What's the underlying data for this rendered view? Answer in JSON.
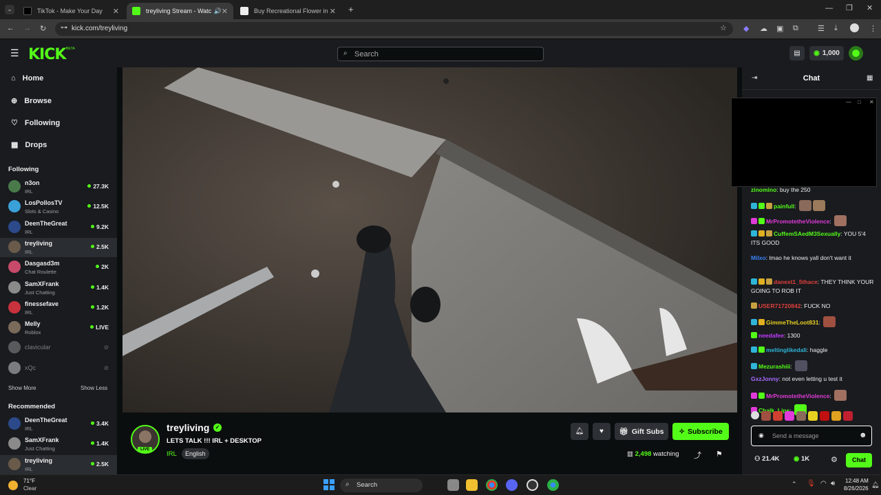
{
  "browser": {
    "tabs": [
      {
        "title": "TikTok - Make Your Day",
        "active": false
      },
      {
        "title": "treyliving Stream - Watch Li",
        "active": true
      },
      {
        "title": "Buy Recreational Flower in Las",
        "active": false
      }
    ],
    "url": "kick.com/treyliving"
  },
  "header": {
    "logo": "KICK",
    "beta": "BETA",
    "search_placeholder": "Search",
    "coins": "1,000"
  },
  "sidebar": {
    "nav": [
      {
        "label": "Home",
        "icon": "home-icon"
      },
      {
        "label": "Browse",
        "icon": "compass-icon"
      },
      {
        "label": "Following",
        "icon": "heart-icon"
      },
      {
        "label": "Drops",
        "icon": "gift-icon"
      }
    ],
    "following_title": "Following",
    "following": [
      {
        "name": "n3on",
        "category": "IRL",
        "viewers": "27.3K",
        "color": "#4a7a4a"
      },
      {
        "name": "LosPollosTV",
        "category": "Slots & Casino",
        "viewers": "12.5K",
        "color": "#3aa0d8"
      },
      {
        "name": "DeenTheGreat",
        "category": "IRL",
        "viewers": "9.2K",
        "color": "#2c4a8a"
      },
      {
        "name": "treyliving",
        "category": "IRL",
        "viewers": "2.5K",
        "color": "#6a5a4a",
        "selected": true
      },
      {
        "name": "Dasgasd3m",
        "category": "Chat Roulette",
        "viewers": "2K",
        "color": "#c84a6a"
      },
      {
        "name": "SamXFrank",
        "category": "Just Chatting",
        "viewers": "1.4K",
        "color": "#8a8a8a"
      },
      {
        "name": "finessefave",
        "category": "IRL",
        "viewers": "1.2K",
        "color": "#c8323c"
      },
      {
        "name": "Melly",
        "category": "Roblox",
        "viewers": "LIVE",
        "color": "#7a6a5a"
      },
      {
        "name": "clavicular",
        "category": "",
        "viewers": "",
        "color": "#9a9a9a",
        "offline": true
      },
      {
        "name": "xQc",
        "category": "",
        "viewers": "",
        "color": "#dddddd",
        "offline": true
      }
    ],
    "show_more": "Show More",
    "show_less": "Show Less",
    "recommended_title": "Recommended",
    "recommended": [
      {
        "name": "DeenTheGreat",
        "category": "IRL",
        "viewers": "3.4K",
        "color": "#2c4a8a"
      },
      {
        "name": "SamXFrank",
        "category": "Just Chatting",
        "viewers": "1.4K",
        "color": "#8a8a8a"
      },
      {
        "name": "treyliving",
        "category": "IRL",
        "viewers": "2.5K",
        "color": "#6a5a4a",
        "selected": true
      }
    ]
  },
  "stream": {
    "username": "treyliving",
    "live_badge": "LIVE",
    "title": "LETS TALK !!! IRL + DESKTOP",
    "category": "IRL",
    "language": "English",
    "gift_subs_label": "Gift Subs",
    "subscribe_label": "Subscribe",
    "viewers": "2,498",
    "watching_label": "watching"
  },
  "chat": {
    "title": "Chat",
    "messages": [
      {
        "user": "zinomino",
        "color": "#53fc18",
        "text": "buy the 250",
        "badges": []
      },
      {
        "user": "painfull",
        "color": "#53fc18",
        "text": "",
        "badges": [
          "#2fb5d8",
          "#53fc18",
          "#c8a040"
        ],
        "emotes": [
          "#8a6a5a",
          "#9a7a5a"
        ]
      },
      {
        "user": "MrPromotetheViolence",
        "color": "#e03bd8",
        "text": "",
        "badges": [
          "#e03bd8",
          "#53fc18"
        ],
        "emotes": [
          "#a07060"
        ]
      },
      {
        "user": "CuffemSAedM3Sexually",
        "color": "#53fc18",
        "text": "YOU 5'4 ITS GOOD",
        "badges": [
          "#2fb5d8",
          "#e0b020",
          "#c8a040"
        ]
      },
      {
        "user": "Milxo",
        "color": "#3b82f6",
        "text": "lmao he knows yall don't want it",
        "badges": []
      },
      {
        "user": "danext1_5thace",
        "color": "#e0403b",
        "text": "THEY THINK YOUR GOING TO ROB IT",
        "badges": [
          "#2fb5d8",
          "#e0b020",
          "#c8a040"
        ]
      },
      {
        "user": "USER71720842",
        "color": "#e0403b",
        "text": "FUCK NO",
        "badges": [
          "#c8a040"
        ]
      },
      {
        "user": "GimmeTheLoot831",
        "color": "#e8d020",
        "text": "",
        "badges": [
          "#2fb5d8",
          "#e0b020"
        ],
        "emotes": [
          "#a05040"
        ]
      },
      {
        "user": "needafee",
        "color": "#c23bff",
        "text": "1300",
        "badges": [
          "#53fc18"
        ]
      },
      {
        "user": "meltinglikedali",
        "color": "#2fb5d8",
        "text": "haggle",
        "badges": [
          "#2fb5d8",
          "#53fc18"
        ]
      },
      {
        "user": "Mezurashiii",
        "color": "#53fc18",
        "text": "",
        "badges": [
          "#2fb5d8"
        ],
        "emotes": [
          "#505060"
        ]
      },
      {
        "user": "GxzJonny",
        "color": "#a86bff",
        "text": "not even letting u test it",
        "badges": []
      },
      {
        "user": "MrPromotetheViolence",
        "color": "#e03bd8",
        "text": "",
        "badges": [
          "#e03bd8",
          "#53fc18"
        ],
        "emotes": [
          "#a07060"
        ]
      },
      {
        "user": "Chalk_Lips",
        "color": "#53fc18",
        "text": "",
        "badges": [
          "#e03bd8"
        ],
        "emotes": [
          "#53fc18"
        ]
      }
    ],
    "input_placeholder": "Send a message",
    "send_label": "Chat",
    "stats": {
      "followers": "21.4K",
      "points": "1K"
    }
  },
  "taskbar": {
    "weather_temp": "71°F",
    "weather_desc": "Clear",
    "search_label": "Search",
    "time": "12:48 AM",
    "date": "8/26/2026"
  }
}
